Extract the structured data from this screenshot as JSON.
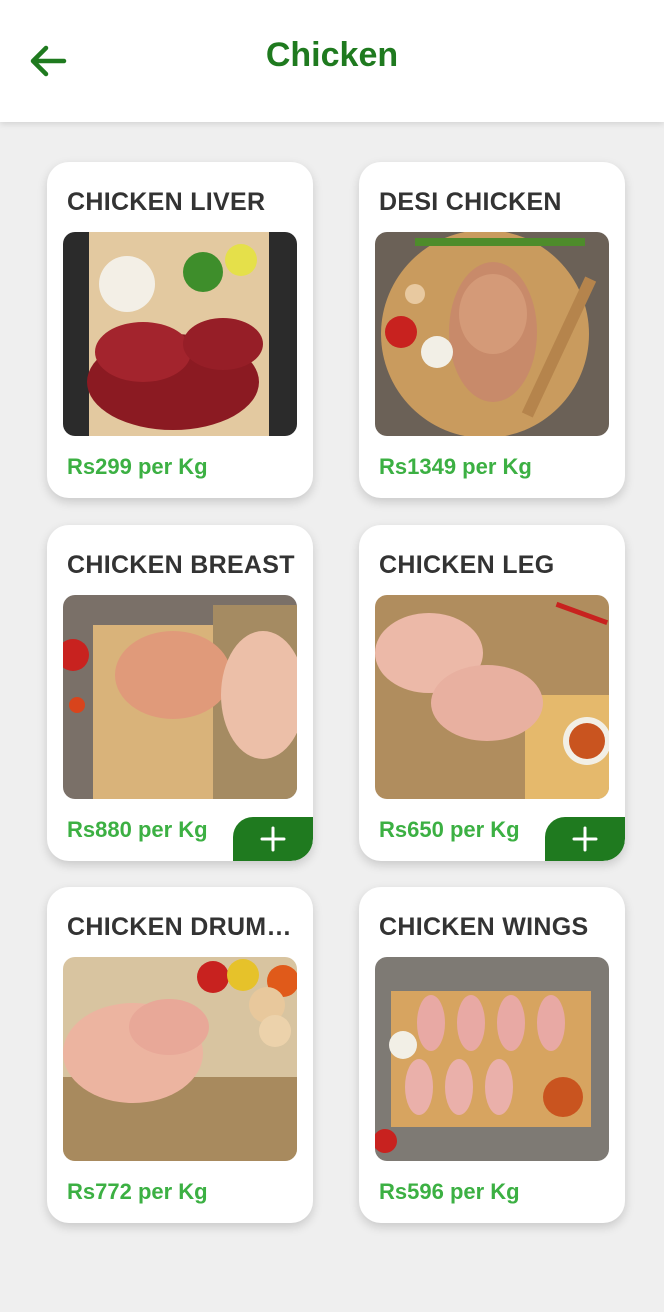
{
  "header": {
    "title": "Chicken",
    "back_icon": "arrow-left-icon",
    "accent_color": "#1f7a1f"
  },
  "price_color": "#3cb043",
  "products": [
    {
      "name": "CHICKEN LIVER",
      "price": "Rs299 per Kg",
      "image": "chicken-liver-photo",
      "add_button": false
    },
    {
      "name": "DESI CHICKEN",
      "price": "Rs1349 per Kg",
      "image": "desi-chicken-photo",
      "add_button": false
    },
    {
      "name": "CHICKEN BREAST",
      "price": "Rs880 per Kg",
      "image": "chicken-breast-photo",
      "add_button": true,
      "add_icon": "plus-icon"
    },
    {
      "name": "CHICKEN LEG",
      "price": "Rs650 per Kg",
      "image": "chicken-leg-photo",
      "add_button": true,
      "add_icon": "plus-icon"
    },
    {
      "name": "CHICKEN DRUMSTICKS",
      "price": "Rs772 per Kg",
      "image": "chicken-drumsticks-photo",
      "add_button": false
    },
    {
      "name": "CHICKEN WINGS",
      "price": "Rs596 per Kg",
      "image": "chicken-wings-photo",
      "add_button": false
    }
  ]
}
